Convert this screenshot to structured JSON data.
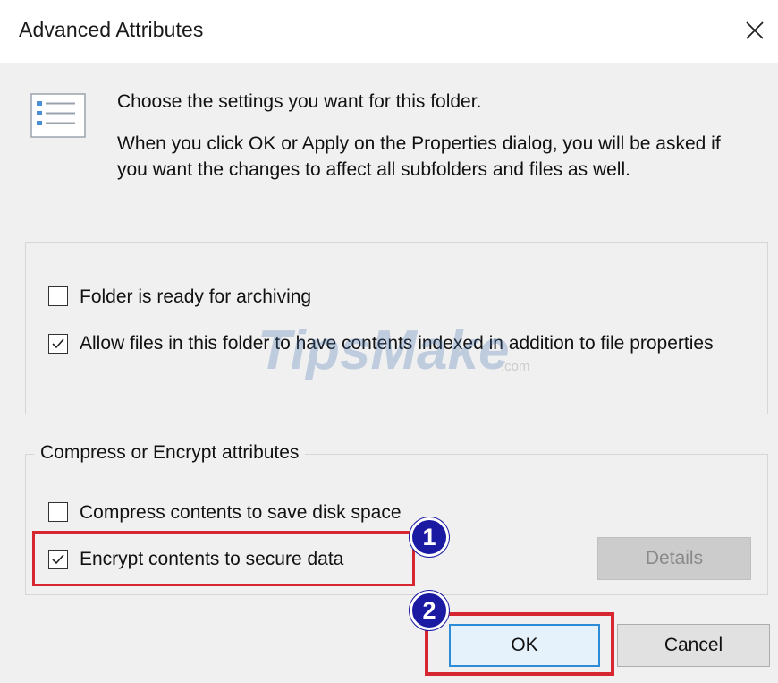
{
  "window": {
    "title": "Advanced Attributes",
    "close_icon": "close-icon"
  },
  "intro": {
    "icon": "settings-list-icon",
    "line1": "Choose the settings you want for this folder.",
    "line2": "When you click OK or Apply on the Properties dialog, you will be asked if you want the changes to affect all subfolders and files as well."
  },
  "archive_index": {
    "archiving": {
      "label": "Folder is ready for archiving",
      "checked": false
    },
    "indexing": {
      "label": "Allow files in this folder to have contents indexed in addition to file properties",
      "checked": true
    }
  },
  "compress_encrypt": {
    "legend": "Compress or Encrypt attributes",
    "compress": {
      "label": "Compress contents to save disk space",
      "checked": false
    },
    "encrypt": {
      "label": "Encrypt contents to secure data",
      "checked": true
    },
    "details_label": "Details"
  },
  "buttons": {
    "ok_label": "OK",
    "cancel_label": "Cancel"
  },
  "annotations": {
    "badge1": "1",
    "badge2": "2",
    "highlight_color": "#d6262f",
    "badge_color": "#1a1aa3"
  },
  "watermark": {
    "brand": "TipsMake",
    "suffix": ".com"
  }
}
